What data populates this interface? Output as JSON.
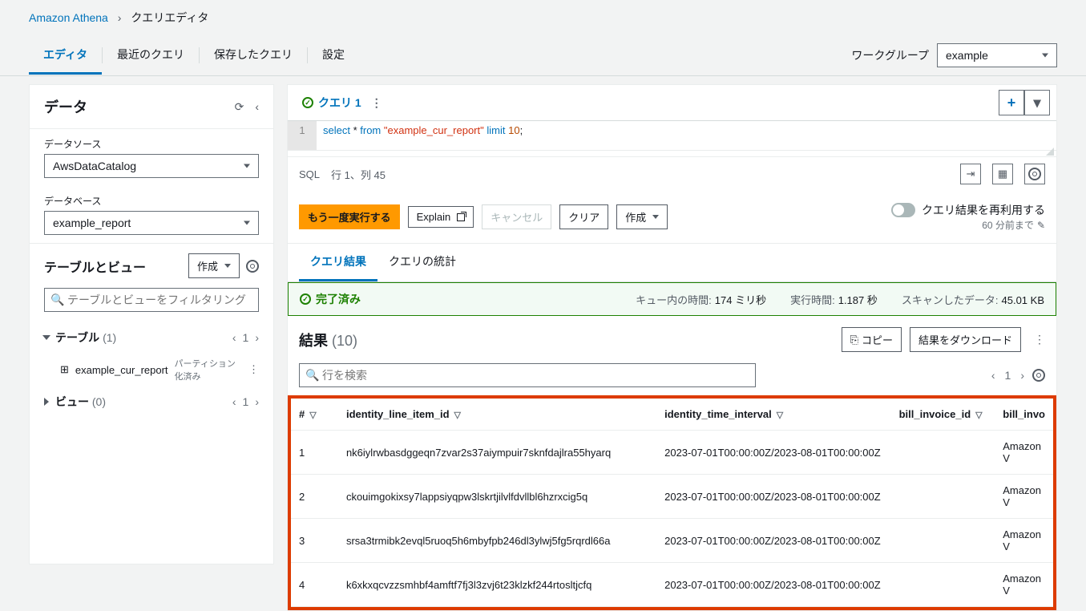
{
  "breadcrumb": {
    "root": "Amazon Athena",
    "current": "クエリエディタ"
  },
  "tabs": {
    "editor": "エディタ",
    "recent": "最近のクエリ",
    "saved": "保存したクエリ",
    "settings": "設定"
  },
  "workgroup": {
    "label": "ワークグループ",
    "value": "example"
  },
  "sidebar": {
    "title": "データ",
    "datasource": {
      "label": "データソース",
      "value": "AwsDataCatalog"
    },
    "database": {
      "label": "データベース",
      "value": "example_report"
    },
    "tables_views": {
      "title": "テーブルとビュー",
      "create": "作成"
    },
    "filter_placeholder": "テーブルとビューをフィルタリング",
    "tables": {
      "label": "テーブル",
      "count": "(1)",
      "page": "1"
    },
    "table_item": {
      "name": "example_cur_report",
      "tag": "パーティション化済み"
    },
    "views": {
      "label": "ビュー",
      "count": "(0)",
      "page": "1"
    }
  },
  "query": {
    "tab": "クエリ 1",
    "line": "1",
    "sql": {
      "select": "select",
      "star": " * ",
      "from": "from",
      "sp": " ",
      "str": "\"example_cur_report\"",
      "limit": " limit ",
      "num": "10",
      "semi": ";"
    },
    "status": {
      "lang": "SQL",
      "pos": "行 1、列 45"
    }
  },
  "actions": {
    "run": "もう一度実行する",
    "explain": "Explain",
    "cancel": "キャンセル",
    "clear": "クリア",
    "create": "作成",
    "reuse": "クエリ結果を再利用する",
    "reuse_sub": "60 分前まで"
  },
  "result_tabs": {
    "results": "クエリ結果",
    "stats": "クエリの統計"
  },
  "banner": {
    "done": "完了済み",
    "queue": {
      "label": "キュー内の時間:",
      "value": "174 ミリ秒"
    },
    "exec": {
      "label": "実行時間:",
      "value": "1.187 秒"
    },
    "scan": {
      "label": "スキャンしたデータ:",
      "value": "45.01 KB"
    }
  },
  "results": {
    "title": "結果",
    "count": "(10)",
    "copy": "コピー",
    "download": "結果をダウンロード",
    "search_placeholder": "行を検索",
    "page": "1",
    "columns": {
      "n": "#",
      "c1": "identity_line_item_id",
      "c2": "identity_time_interval",
      "c3": "bill_invoice_id",
      "c4": "bill_invo"
    },
    "rows": [
      {
        "n": "1",
        "id": "nk6iylrwbasdggeqn7zvar2s37aiympuir7sknfdajlra55hyarq",
        "t": "2023-07-01T00:00:00Z/2023-08-01T00:00:00Z",
        "b": "",
        "b2": "Amazon V"
      },
      {
        "n": "2",
        "id": "ckouimgokixsy7lappsiyqpw3lskrtjilvlfdvllbl6hzrxcig5q",
        "t": "2023-07-01T00:00:00Z/2023-08-01T00:00:00Z",
        "b": "",
        "b2": "Amazon V"
      },
      {
        "n": "3",
        "id": "srsa3trmibk2evql5ruoq5h6mbyfpb246dl3ylwj5fg5rqrdl66a",
        "t": "2023-07-01T00:00:00Z/2023-08-01T00:00:00Z",
        "b": "",
        "b2": "Amazon V"
      },
      {
        "n": "4",
        "id": "k6xkxqcvzzsmhbf4amftf7fj3l3zvj6t23klzkf244rtosltjcfq",
        "t": "2023-07-01T00:00:00Z/2023-08-01T00:00:00Z",
        "b": "",
        "b2": "Amazon V"
      }
    ]
  }
}
